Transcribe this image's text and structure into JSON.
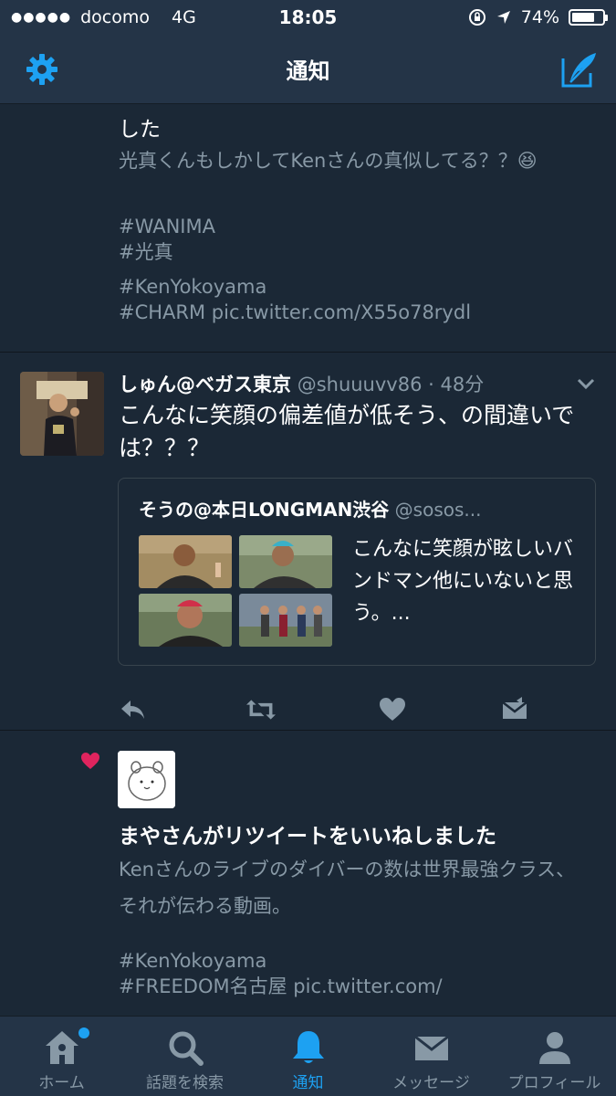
{
  "status_bar": {
    "carrier": "docomo",
    "network": "4G",
    "time": "18:05",
    "battery": "74%",
    "battery_level": 0.74
  },
  "header": {
    "title": "通知"
  },
  "tweets": [
    {
      "partial_line": "した",
      "body": "光真くんもしかしてKenさんの真似してる？？😆",
      "hashtags": [
        "#WANIMA",
        "#光真"
      ],
      "hashtags2": [
        "#KenYokoyama",
        "#CHARM pic.twitter.com/X55o78rydl"
      ]
    },
    {
      "name": "しゅん@ベガス東京",
      "handle": "@shuuuvv86 · 48分",
      "text": "こんなに笑顔の偏差値が低そう、の間違いでは？？？",
      "quote": {
        "name": "そうの@本日LONGMAN渋谷",
        "handle": "@sosos...",
        "text": "こんなに笑顔が眩しいバンドマン他にいないと思う。..."
      }
    },
    {
      "title": "まやさんがリツイートをいいねしました",
      "body": "Kenさんのライブのダイバーの数は世界最強クラス、それが伝わる動画。",
      "hashtags": [
        "#KenYokoyama",
        "#FREEDOM名古屋 pic.twitter.com/"
      ]
    }
  ],
  "tabs": [
    {
      "label": "ホーム",
      "icon": "home-icon"
    },
    {
      "label": "話題を検索",
      "icon": "search-icon"
    },
    {
      "label": "通知",
      "icon": "bell-icon"
    },
    {
      "label": "メッセージ",
      "icon": "envelope-icon"
    },
    {
      "label": "プロフィール",
      "icon": "person-icon"
    }
  ],
  "colors": {
    "accent": "#1da1f2",
    "background": "#1b2836",
    "bar": "#243447",
    "grey_text": "#8899a6",
    "like": "#e0245e"
  }
}
